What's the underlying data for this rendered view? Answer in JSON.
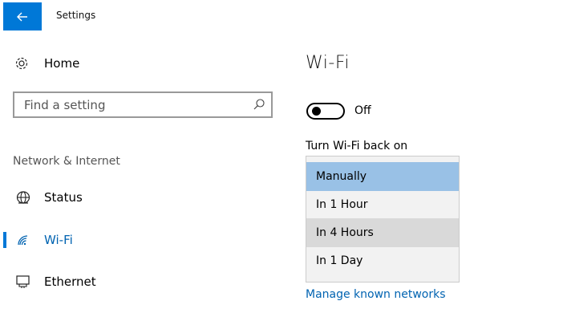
{
  "window": {
    "title": "Settings"
  },
  "sidebar": {
    "home_label": "Home",
    "search_placeholder": "Find a setting",
    "section_label": "Network & Internet",
    "items": [
      {
        "label": "Status",
        "icon": "globe-icon",
        "active": false
      },
      {
        "label": "Wi-Fi",
        "icon": "wifi-icon",
        "active": true
      },
      {
        "label": "Ethernet",
        "icon": "ethernet-icon",
        "active": false
      }
    ]
  },
  "main": {
    "heading": "Wi-Fi",
    "toggle_label": "Off",
    "turn_on_label": "Turn Wi-Fi back on",
    "dropdown_options": [
      "Manually",
      "In 1 Hour",
      "In 4 Hours",
      "In 1 Day"
    ],
    "selected_option": "Manually",
    "manage_link": "Manage known networks"
  },
  "colors": {
    "accent": "#0078d7",
    "link": "#0063b1",
    "selected": "#99c1e6"
  }
}
